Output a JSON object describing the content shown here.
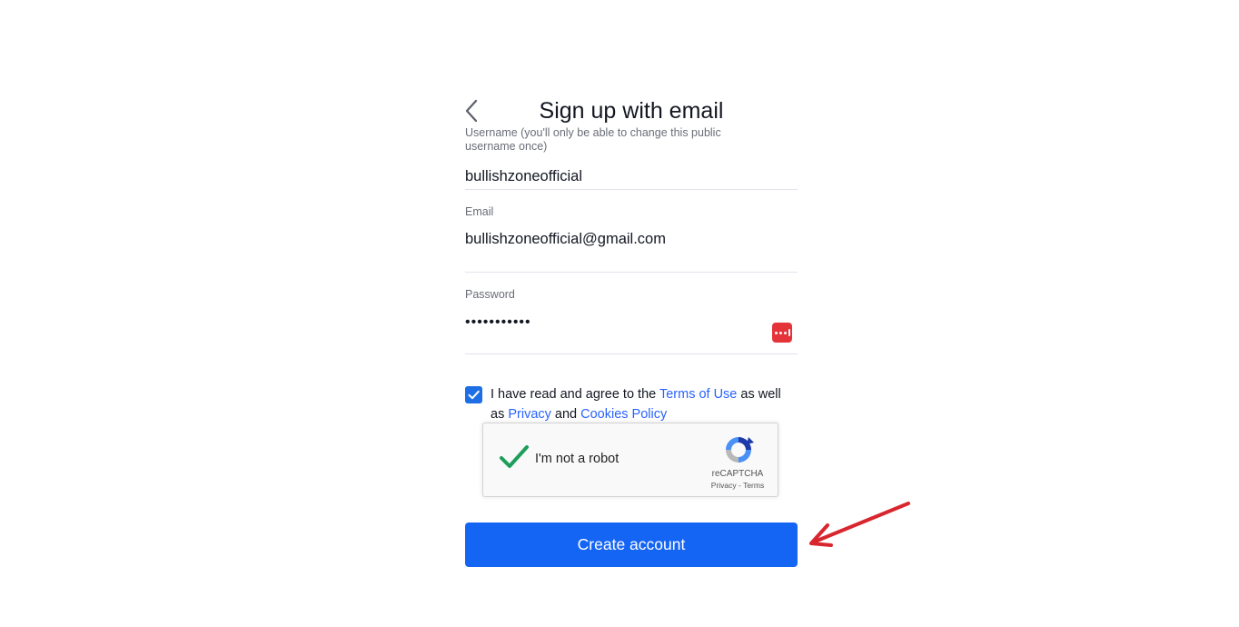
{
  "header": {
    "title": "Sign up with email",
    "back_icon": "chevron-left-icon"
  },
  "fields": {
    "username": {
      "label": "Username (you'll only be able to change this public username once)",
      "value": "bullishzoneofficial"
    },
    "email": {
      "label": "Email",
      "value": "bullishzoneofficial@gmail.com"
    },
    "password": {
      "label": "Password",
      "value": "•••••••••••",
      "manager_icon": "password-manager-icon"
    }
  },
  "agreement": {
    "checked": true,
    "text_before": "I have read and agree to the ",
    "terms_link": "Terms of Use",
    "text_middle1": " as well as ",
    "privacy_link": "Privacy",
    "text_middle2": " and ",
    "cookies_link": "Cookies Policy"
  },
  "recaptcha": {
    "label": "I'm not a robot",
    "brand": "reCAPTCHA",
    "privacy_link": "Privacy",
    "separator": " - ",
    "terms_link": "Terms",
    "checked": true
  },
  "actions": {
    "create_label": "Create account"
  },
  "colors": {
    "primary": "#1565f5",
    "link": "#2962ff",
    "annotation_arrow": "#d9262e",
    "recaptcha_check": "#1e9e5a"
  }
}
